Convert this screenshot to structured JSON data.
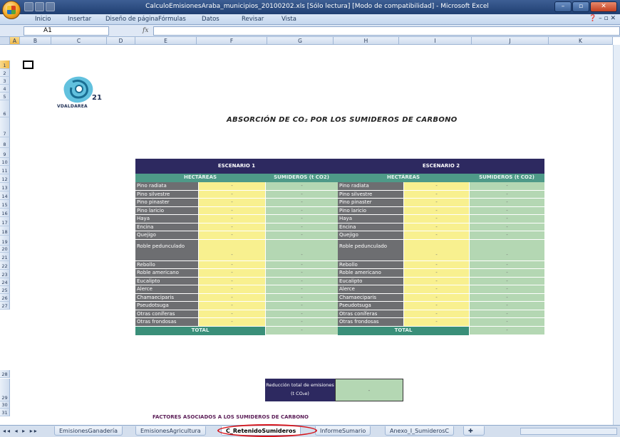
{
  "window": {
    "title": "CalculoEmisionesAraba_municipios_20100202.xls  [Sólo lectura]  [Modo de compatibilidad] - Microsoft Excel",
    "controls": [
      "–",
      "▫",
      "✕"
    ]
  },
  "ribbon": {
    "tabs": [
      "Inicio",
      "Insertar",
      "Diseño de página",
      "Fórmulas",
      "Datos",
      "Revisar",
      "Vista"
    ]
  },
  "formula_bar": {
    "cell_ref": "A1",
    "fx": "fx",
    "formula": ""
  },
  "columns": [
    "A",
    "B",
    "C",
    "D",
    "E",
    "F",
    "G",
    "H",
    "I",
    "J",
    "K"
  ],
  "rows": [
    "1",
    "2",
    "3",
    "4",
    "5",
    "6",
    "7",
    "8",
    "9",
    "10",
    "11",
    "12",
    "13",
    "14",
    "15",
    "16",
    "17",
    "18",
    "19",
    "20",
    "21",
    "22",
    "23",
    "24",
    "25",
    "26",
    "27",
    "28",
    "29",
    "30",
    "31"
  ],
  "logo": {
    "wordmark": "VDALDAREA",
    "number": "21"
  },
  "heading": "ABSORCIÓN DE CO₂ POR LOS SUMIDEROS DE CARBONO",
  "scenario1": {
    "title": "ESCENARIO 1",
    "col_ha": "HECTÁREAS",
    "col_sum": "SUMIDEROS (t CO2)"
  },
  "scenario2": {
    "title": "ESCENARIO 2",
    "col_ha": "HECTÁREAS",
    "col_sum": "SUMIDEROS (t CO2)"
  },
  "species": [
    "Pino radiata",
    "Pino silvestre",
    "Pino pinaster",
    "Pino laricio",
    "Haya",
    "Encina",
    "Quejigo",
    "Roble pedunculado",
    "Rebollo",
    "Roble americano",
    "Eucalipto",
    "Alerce",
    "Chamaeciparis",
    "Pseudotsuga",
    "Otras coníferas",
    "Otras frondosas"
  ],
  "cell_value": "-",
  "total_label": "TOTAL",
  "reduction": {
    "label": "Reducción total de emisiones (t CO₂e)",
    "value": "-"
  },
  "factors_label": "FACTORES ASOCIADOS A LOS SUMIDEROS DE CARBONO",
  "sheet_tabs": [
    "EmisionesGanadería",
    "EmisionesAgricultura",
    "C_RetenidoSumideros",
    "InformeSumario",
    "Anexo_I_SumiderosC"
  ],
  "active_tab": "C_RetenidoSumideros",
  "nav_buttons": "◂◂ ◂ ▸ ▸▸"
}
